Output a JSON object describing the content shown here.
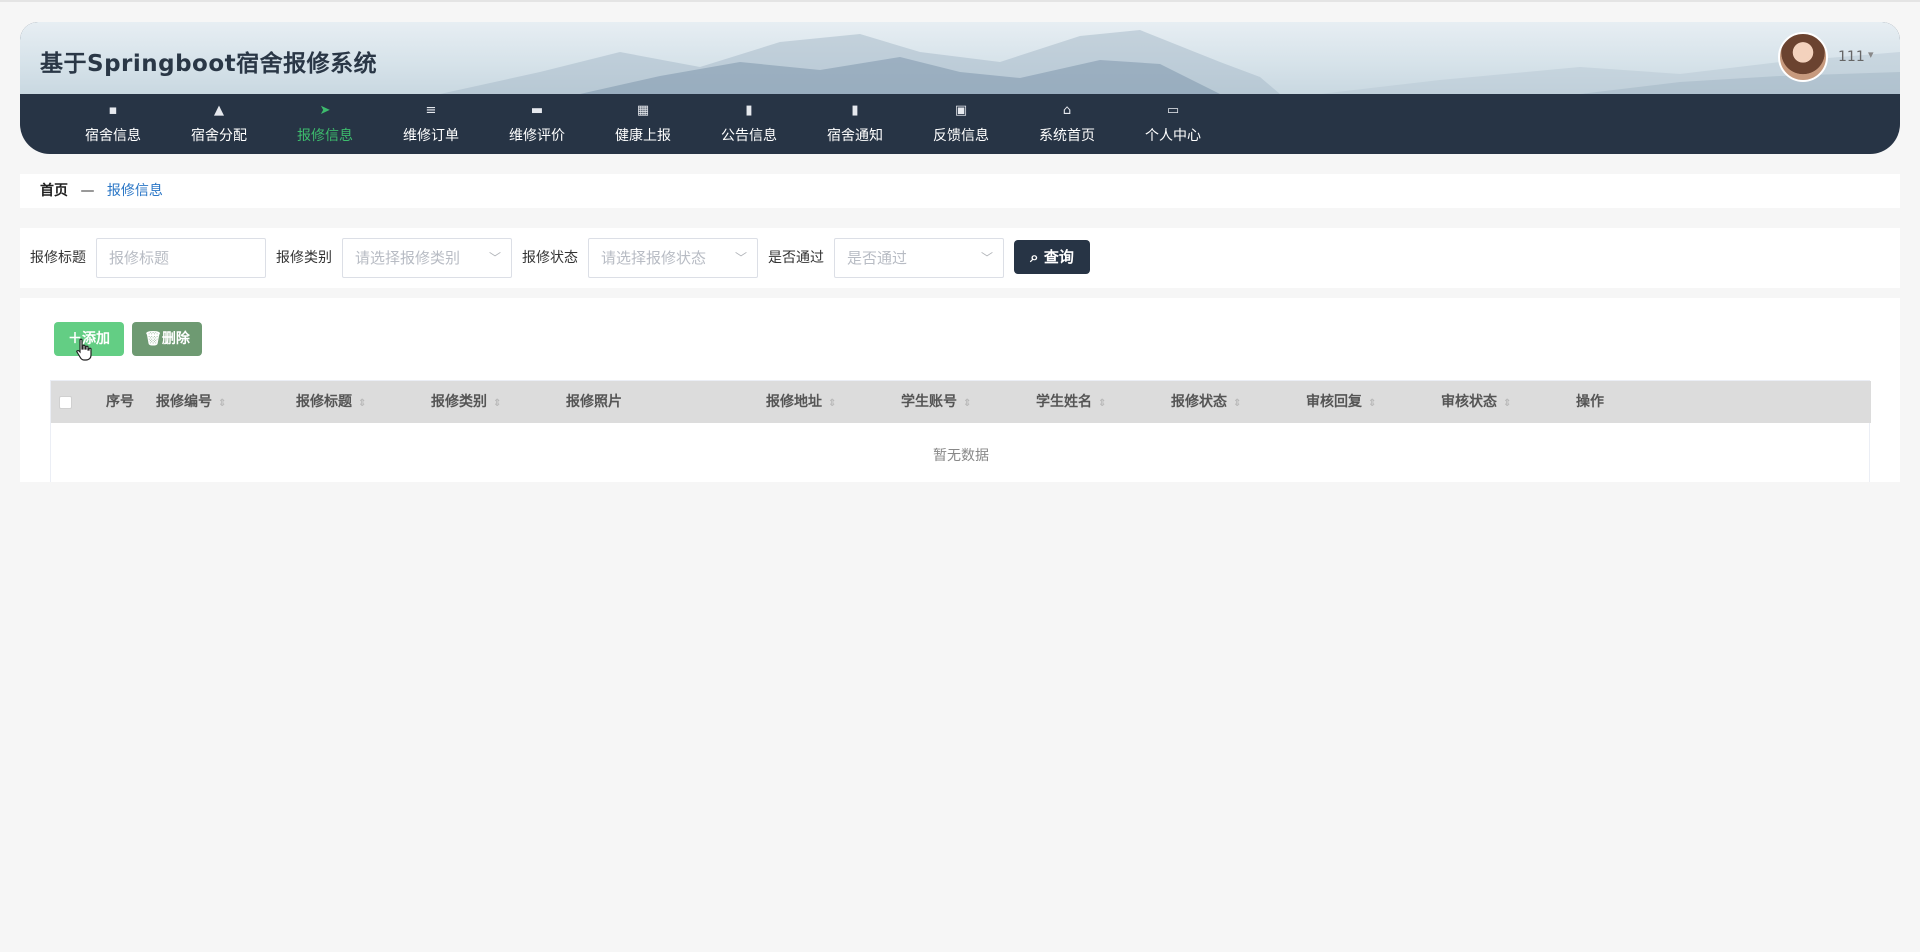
{
  "header": {
    "title": "基于Springboot宿舍报修系统",
    "user": {
      "name": "111",
      "caret": "▾"
    }
  },
  "nav": [
    {
      "label": "宿舍信息",
      "icon": "▪",
      "icon_name": "dorm-icon",
      "active": false
    },
    {
      "label": "宿舍分配",
      "icon": "▲",
      "icon_name": "user-icon",
      "active": false
    },
    {
      "label": "报修信息",
      "icon": "➤",
      "icon_name": "send-icon",
      "active": true
    },
    {
      "label": "维修订单",
      "icon": "≡",
      "icon_name": "list-icon",
      "active": false
    },
    {
      "label": "维修评价",
      "icon": "▬",
      "icon_name": "comment-icon",
      "active": false
    },
    {
      "label": "健康上报",
      "icon": "▦",
      "icon_name": "grid-icon",
      "active": false
    },
    {
      "label": "公告信息",
      "icon": "▮",
      "icon_name": "clipboard-icon",
      "active": false
    },
    {
      "label": "宿舍通知",
      "icon": "▮",
      "icon_name": "clipboard-check-icon",
      "active": false
    },
    {
      "label": "反馈信息",
      "icon": "▣",
      "icon_name": "chart-icon",
      "active": false
    },
    {
      "label": "系统首页",
      "icon": "⌂",
      "icon_name": "home-icon",
      "active": false
    },
    {
      "label": "个人中心",
      "icon": "▭",
      "icon_name": "card-icon",
      "active": false
    }
  ],
  "breadcrumb": {
    "home": "首页",
    "separator": "—",
    "current": "报修信息"
  },
  "search": {
    "title_label": "报修标题",
    "title_placeholder": "报修标题",
    "category_label": "报修类别",
    "category_placeholder": "请选择报修类别",
    "status_label": "报修状态",
    "status_placeholder": "请选择报修状态",
    "pass_label": "是否通过",
    "pass_placeholder": "是否通过",
    "query_button": "查询"
  },
  "toolbar": {
    "add_label": "添加",
    "delete_label": "删除"
  },
  "table": {
    "columns": [
      "序号",
      "报修编号",
      "报修标题",
      "报修类别",
      "报修照片",
      "报修地址",
      "学生账号",
      "学生姓名",
      "报修状态",
      "审核回复",
      "审核状态",
      "操作"
    ],
    "sortable": [
      false,
      true,
      true,
      true,
      false,
      true,
      true,
      true,
      true,
      true,
      true,
      false
    ],
    "rows": [],
    "empty_text": "暂无数据"
  },
  "colors": {
    "nav_bg": "#273445",
    "nav_active": "#3dbb6d",
    "add_button": "#63ce84",
    "delete_button": "#6e9a72",
    "query_button": "#273445",
    "breadcrumb_link": "#2a76c6"
  }
}
